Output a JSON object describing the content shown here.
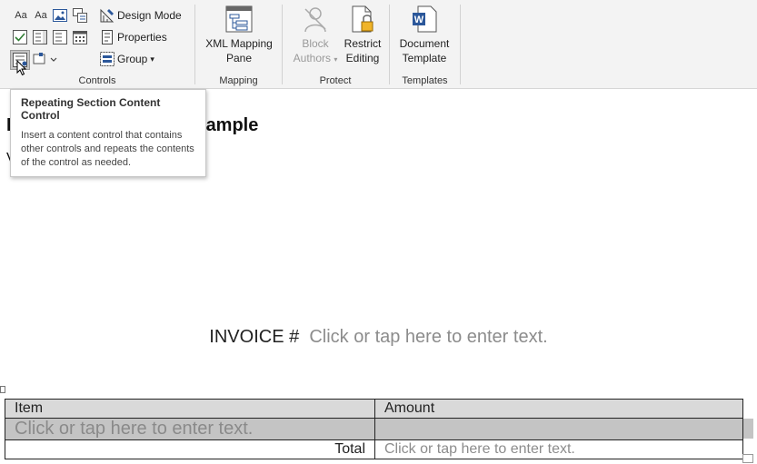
{
  "ribbon": {
    "controls": {
      "label": "Controls",
      "plain_text_glyph": "Aa",
      "rich_text_glyph": "Aa",
      "design_mode": "Design Mode",
      "properties": "Properties",
      "group": "Group"
    },
    "mapping": {
      "label": "Mapping",
      "xml_line1": "XML Mapping",
      "xml_line2": "Pane"
    },
    "protect": {
      "label": "Protect",
      "block_line1": "Block",
      "block_line2": "Authors",
      "restrict_line1": "Restrict",
      "restrict_line2": "Editing"
    },
    "templates": {
      "label": "Templates",
      "doc_line1": "Document",
      "doc_line2": "Template"
    }
  },
  "tooltip": {
    "title": "Repeating Section Content Control",
    "body": "Insert a content control that contains other controls and repeats the contents of the control as needed."
  },
  "document": {
    "heading_visible": "I",
    "heading_tail": "ample",
    "sub_visible": "V",
    "invoice_label": "INVOICE #",
    "invoice_placeholder": "Click or tap here to enter text.",
    "table": {
      "headers": [
        "Item",
        "Amount"
      ],
      "repeat_placeholder": "Click or tap here to enter text.",
      "total_label": "Total",
      "total_placeholder": "Click or tap here to enter text."
    }
  },
  "colors": {
    "accent_blue": "#2b579a",
    "ribbon_bg": "#f3f3f3",
    "placeholder_gray": "#8c8c8c",
    "repeat_section_gray": "#c4c4c4"
  }
}
